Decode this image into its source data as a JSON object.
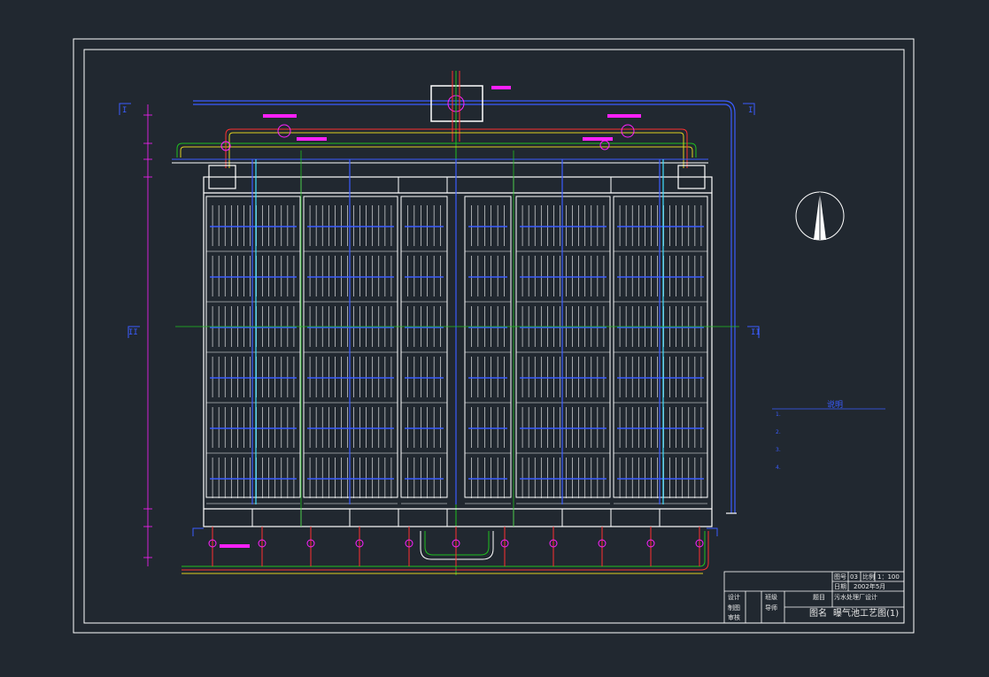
{
  "colors": {
    "background": "#212830",
    "frame": "#ffffff",
    "wall": "#ffffff",
    "pipe_blue": "#3a5cff",
    "pipe_green": "#20c020",
    "pipe_red": "#ff3030",
    "pipe_yellow": "#e0d020",
    "magenta": "#ff20ff",
    "cyan": "#40e0ff"
  },
  "title_block": {
    "drawing_no_label": "图号",
    "drawing_no": "03",
    "scale_label": "比例",
    "scale": "1：100",
    "date_label": "日期",
    "date": "2002年5月",
    "design_label": "设计",
    "draw_label": "制图",
    "review_label": "审核",
    "class_label": "班级",
    "advisor_label": "导师",
    "topic_label": "题目",
    "topic": "污水处理厂设计",
    "name_label": "图名",
    "drawing_name": "曝气池工艺图(1)"
  },
  "notes": {
    "title": "说明",
    "lines": [
      "1. ",
      "   ",
      "2. ",
      "   ",
      "3. ",
      "   ",
      "4. "
    ]
  },
  "section_markers": {
    "left_top": "I",
    "right_top": "I",
    "left_mid": "II",
    "right_mid": "II"
  },
  "north_arrow": "north-arrow"
}
